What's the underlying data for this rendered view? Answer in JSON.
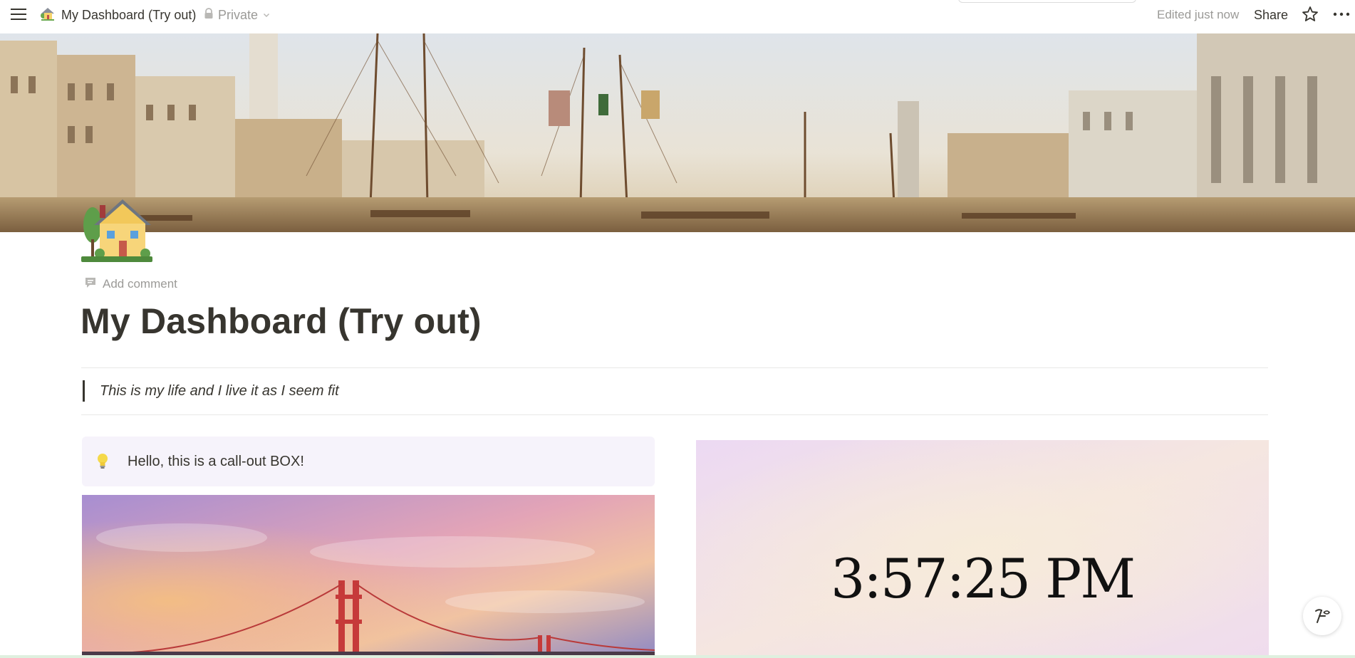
{
  "topbar": {
    "page_title": "My Dashboard (Try out)",
    "privacy_label": "Private",
    "edited_label": "Edited just now",
    "share_label": "Share"
  },
  "page": {
    "title": "My Dashboard (Try out)",
    "add_comment_label": "Add comment",
    "quote": "This is my life and I live it as I seem fit"
  },
  "callout": {
    "text": "Hello, this is a call-out BOX!"
  },
  "clock_widget": {
    "time": "3:57:25 PM"
  },
  "icons": {
    "menu": "hamburger-menu-icon",
    "page_emoji": "house-with-garden-icon",
    "lock": "lock-icon",
    "chevron": "chevron-down-icon",
    "star": "star-icon",
    "more": "more-horizontal-icon",
    "comment": "comment-icon",
    "callout": "light-bulb-icon",
    "help": "ai-assistant-icon"
  },
  "colors": {
    "text": "#37352f",
    "muted": "#9b9a97",
    "callout_bg": "#f6f3fb",
    "divider": "#e9e9e7"
  }
}
